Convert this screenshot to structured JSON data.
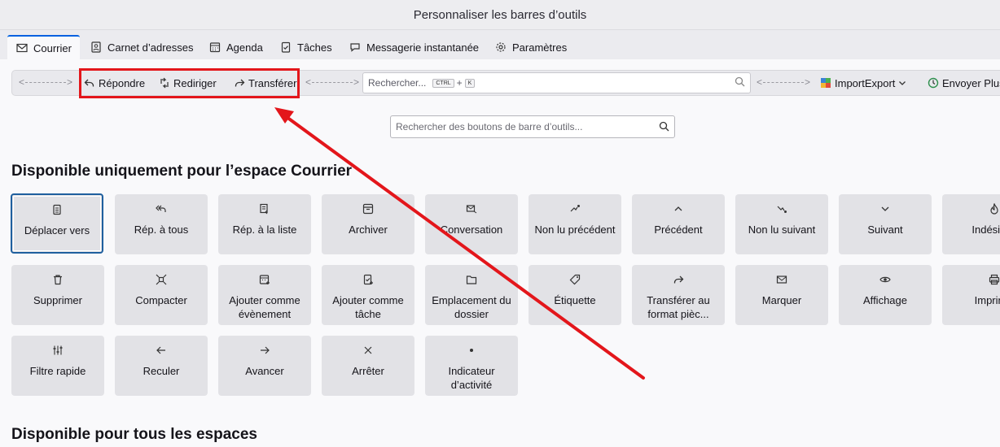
{
  "window": {
    "title": "Personnaliser les barres d’outils"
  },
  "tabs": [
    {
      "label": "Courrier",
      "icon": "mail-icon"
    },
    {
      "label": "Carnet d’adresses",
      "icon": "address-book-icon"
    },
    {
      "label": "Agenda",
      "icon": "calendar-icon"
    },
    {
      "label": "Tâches",
      "icon": "tasks-icon"
    },
    {
      "label": "Messagerie instantanée",
      "icon": "chat-icon"
    },
    {
      "label": "Paramètres",
      "icon": "gear-icon"
    }
  ],
  "toolbar": {
    "reply": "Répondre",
    "redirect": "Rediriger",
    "forward": "Transférer",
    "search_placeholder": "Rechercher...",
    "kbd_ctrl": "CTRL",
    "kbd_plus": "+",
    "kbd_k": "K",
    "importexport": "ImportExport",
    "send_later": "Envoyer Plus"
  },
  "button_search": {
    "placeholder": "Rechercher des boutons de barre d’outils..."
  },
  "sections": {
    "mail_only": "Disponible uniquement pour l’espace Courrier",
    "all_spaces": "Disponible pour tous les espaces"
  },
  "rows": [
    [
      {
        "label": "Déplacer vers",
        "icon": "move-icon"
      },
      {
        "label": "Rép. à tous",
        "icon": "reply-all-icon"
      },
      {
        "label": "Rép. à la liste",
        "icon": "reply-list-icon"
      },
      {
        "label": "Archiver",
        "icon": "archive-icon"
      },
      {
        "label": "Conversation",
        "icon": "conversation-icon"
      },
      {
        "label": "Non lu précédent",
        "icon": "previous-unread-icon"
      },
      {
        "label": "Précédent",
        "icon": "chevron-up-icon"
      },
      {
        "label": "Non lu suivant",
        "icon": "next-unread-icon"
      },
      {
        "label": "Suivant",
        "icon": "chevron-down-icon"
      },
      {
        "label": "Indésira",
        "icon": "junk-icon"
      }
    ],
    [
      {
        "label": "Supprimer",
        "icon": "trash-icon"
      },
      {
        "label": "Compacter",
        "icon": "compact-icon"
      },
      {
        "label": "Ajouter comme évènement",
        "icon": "add-event-icon"
      },
      {
        "label": "Ajouter comme tâche",
        "icon": "add-task-icon"
      },
      {
        "label": "Emplacement du dossier",
        "icon": "folder-icon"
      },
      {
        "label": "Étiquette",
        "icon": "tag-icon"
      },
      {
        "label": "Transférer au format pièc...",
        "icon": "forward-attachment-icon"
      },
      {
        "label": "Marquer",
        "icon": "mark-icon"
      },
      {
        "label": "Affichage",
        "icon": "eye-icon"
      },
      {
        "label": "Imprim",
        "icon": "print-icon"
      }
    ],
    [
      {
        "label": "Filtre rapide",
        "icon": "filter-icon"
      },
      {
        "label": "Reculer",
        "icon": "arrow-left-icon"
      },
      {
        "label": "Avancer",
        "icon": "arrow-right-icon"
      },
      {
        "label": "Arrêter",
        "icon": "stop-icon"
      },
      {
        "label": "Indicateur d’activité",
        "icon": "dot-icon"
      }
    ]
  ],
  "colors": {
    "accent": "#0061e0",
    "annotation": "#e3161b",
    "card": "#e2e2e6"
  }
}
